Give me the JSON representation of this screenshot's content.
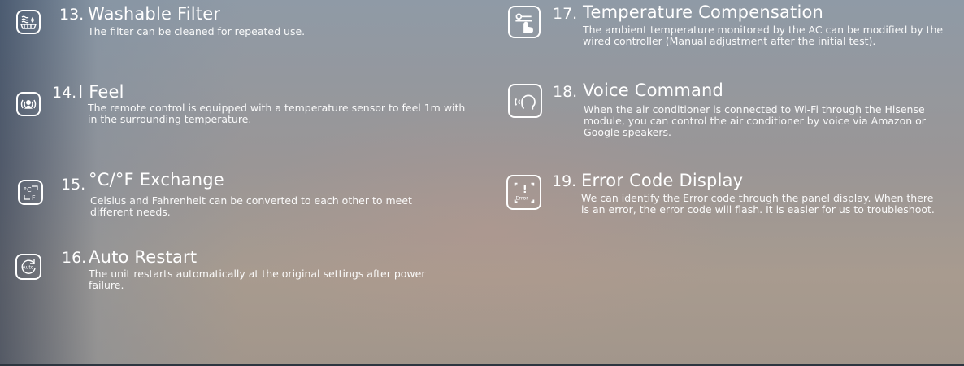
{
  "features": [
    {
      "number": "13.",
      "title": "Washable Filter",
      "desc": "The filter  can be cleaned for repeated use.",
      "icon": "washable-filter-icon"
    },
    {
      "number": "14.",
      "title": "I Feel",
      "desc": "The remote control is equipped with a temperature sensor to feel 1m with in the surrounding temperature.",
      "icon": "i-feel-icon"
    },
    {
      "number": "15.",
      "title": "°C/°F Exchange",
      "desc": "Celsius and Fahrenheit can be converted to each other to meet different needs.",
      "icon": "celsius-fahrenheit-icon"
    },
    {
      "number": "16.",
      "title": "Auto Restart",
      "desc": "The unit restarts automatically at the original settings after power failure.",
      "icon": "auto-restart-icon",
      "icon_text": "Auto"
    },
    {
      "number": "17.",
      "title": "Temperature Compensation",
      "desc": "The ambient temperature monitored by the AC can be modified by the wired controller (Manual adjustment after the initial test).",
      "icon": "temperature-compensation-icon"
    },
    {
      "number": "18.",
      "title": "Voice Command",
      "desc": "When the air conditioner is connected to Wi-Fi through the Hisense module, you can control the air conditioner by voice via Amazon or Google speakers.",
      "icon": "voice-command-icon"
    },
    {
      "number": "19.",
      "title": "Error Code Display",
      "desc": "We can identify the Error code through the panel display. When there is an error, the error code will flash. It is easier for us to troubleshoot.",
      "icon": "error-code-icon",
      "icon_text": "Error"
    }
  ]
}
